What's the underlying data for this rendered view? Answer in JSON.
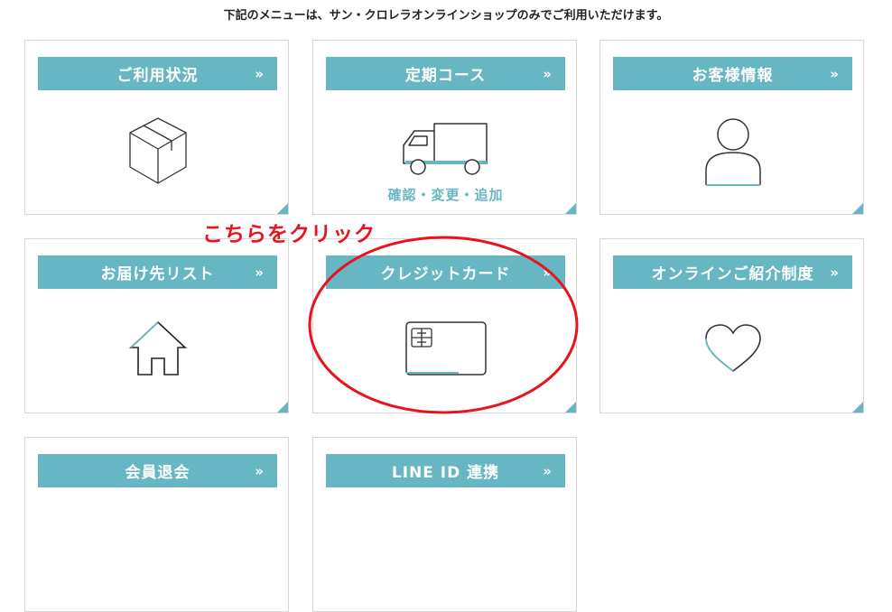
{
  "notice": "下記のメニューは、サン・クロレラオンラインショップのみでご利用いただけます。",
  "chevron": "»",
  "annotation": "こちらをクリック",
  "accent_color": "#66b7c3",
  "annotation_color": "#e8131c",
  "cards": [
    {
      "label": "ご利用状況",
      "icon": "box-icon"
    },
    {
      "label": "定期コース",
      "icon": "truck-icon",
      "caption": "確認・変更・追加"
    },
    {
      "label": "お客様情報",
      "icon": "person-icon"
    },
    {
      "label": "お届け先リスト",
      "icon": "house-icon"
    },
    {
      "label": "クレジットカード",
      "icon": "credit-card-icon"
    },
    {
      "label": "オンラインご紹介制度",
      "icon": "heart-icon"
    },
    {
      "label": "会員退会",
      "icon": ""
    },
    {
      "label": "LINE ID 連携",
      "icon": ""
    }
  ]
}
